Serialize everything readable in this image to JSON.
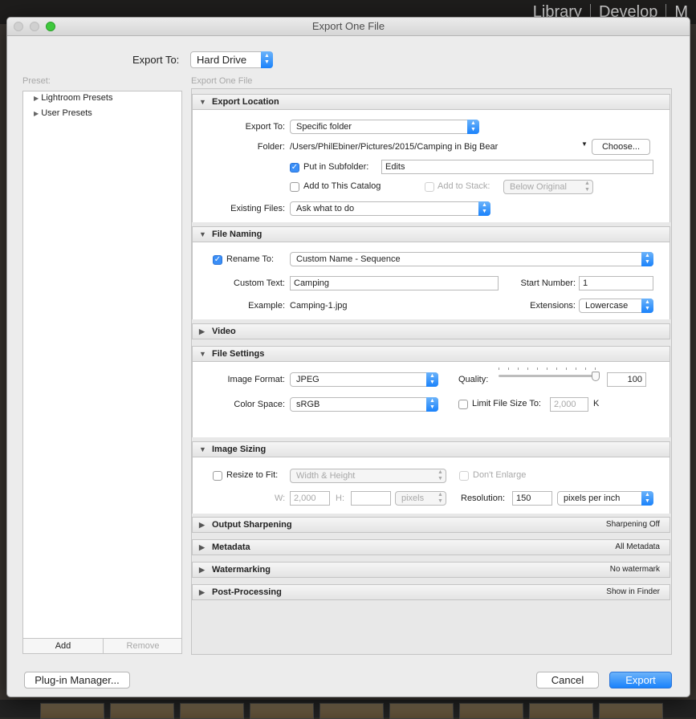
{
  "background": {
    "modules": [
      "Library",
      "Develop",
      "M"
    ]
  },
  "dialog": {
    "title": "Export One File",
    "export_to_label": "Export To:",
    "export_to_value": "Hard Drive",
    "preset_label": "Preset:",
    "preset_group_label": "Export One File",
    "presets": [
      "Lightroom Presets",
      "User Presets"
    ],
    "add_label": "Add",
    "remove_label": "Remove",
    "plugin_manager_label": "Plug-in Manager...",
    "cancel_label": "Cancel",
    "export_label": "Export"
  },
  "export_location": {
    "title": "Export Location",
    "export_to_label": "Export To:",
    "export_to_value": "Specific folder",
    "folder_label": "Folder:",
    "folder_path": "/Users/PhilEbiner/Pictures/2015/Camping in Big Bear",
    "choose_label": "Choose...",
    "subfolder_label": "Put in Subfolder:",
    "subfolder_value": "Edits",
    "add_catalog_label": "Add to This Catalog",
    "add_stack_label": "Add to Stack:",
    "stack_value": "Below Original",
    "existing_label": "Existing Files:",
    "existing_value": "Ask what to do"
  },
  "file_naming": {
    "title": "File Naming",
    "rename_label": "Rename To:",
    "rename_value": "Custom Name - Sequence",
    "custom_text_label": "Custom Text:",
    "custom_text_value": "Camping",
    "start_number_label": "Start Number:",
    "start_number_value": "1",
    "example_label": "Example:",
    "example_value": "Camping-1.jpg",
    "extensions_label": "Extensions:",
    "extensions_value": "Lowercase"
  },
  "video": {
    "title": "Video"
  },
  "file_settings": {
    "title": "File Settings",
    "format_label": "Image Format:",
    "format_value": "JPEG",
    "quality_label": "Quality:",
    "quality_value": "100",
    "color_space_label": "Color Space:",
    "color_space_value": "sRGB",
    "limit_label": "Limit File Size To:",
    "limit_value": "2,000",
    "limit_unit": "K"
  },
  "image_sizing": {
    "title": "Image Sizing",
    "resize_label": "Resize to Fit:",
    "resize_value": "Width & Height",
    "dont_enlarge_label": "Don't Enlarge",
    "w_label": "W:",
    "w_value": "2,000",
    "h_label": "H:",
    "h_value": "",
    "units_value": "pixels",
    "resolution_label": "Resolution:",
    "resolution_value": "150",
    "resolution_unit": "pixels per inch"
  },
  "collapsed_sections": [
    {
      "title": "Output Sharpening",
      "summary": "Sharpening Off"
    },
    {
      "title": "Metadata",
      "summary": "All Metadata"
    },
    {
      "title": "Watermarking",
      "summary": "No watermark"
    },
    {
      "title": "Post-Processing",
      "summary": "Show in Finder"
    }
  ],
  "colors": {
    "accent": "#1a82fb",
    "traffic_green": "#3fc83d"
  }
}
